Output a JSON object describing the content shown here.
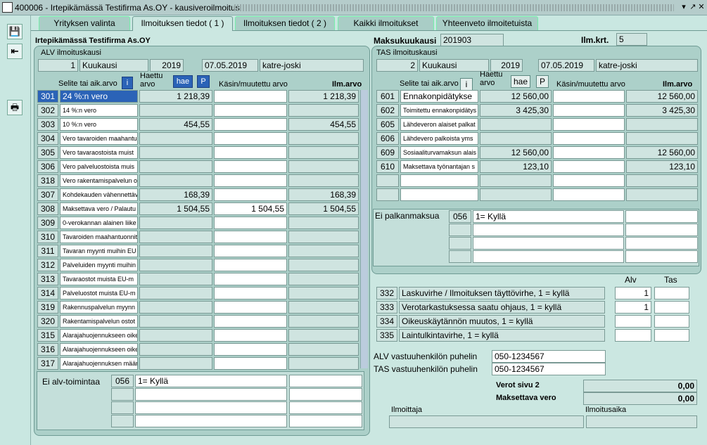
{
  "window": {
    "title": "400006 - Irtepikämässä Testifirma As.OY - kausiveroilmoitus"
  },
  "tabs": [
    "Yrityksen valinta",
    "Ilmoituksen tiedot ( 1 )",
    "Ilmoituksen tiedot ( 2 )",
    "Kaikki ilmoitukset",
    "Yhteenveto ilmoitetuista"
  ],
  "company": "Irtepikämässä Testifirma As.OY",
  "maksukuukausi": {
    "label": "Maksukuukausi",
    "value": "201903"
  },
  "ilmkrt": {
    "label": "Ilm.krt.",
    "value": "5"
  },
  "alv": {
    "title": "ALV ilmoituskausi",
    "period_num": "1",
    "period_type": "Kuukausi",
    "year": "2019",
    "date": "07.05.2019",
    "user": "katre-joski",
    "col_selite": "Selite tai aik.arvo",
    "col_haettu1": "Haettu",
    "col_haettu2": "arvo",
    "col_kasin": "Käsin/muutettu arvo",
    "col_ilm": "Ilm.arvo",
    "btn_i": "i",
    "btn_hae": "hae",
    "btn_p": "P",
    "rows": [
      {
        "code": "301",
        "desc": "24 %:n vero",
        "haettu": "1 218,39",
        "kasin": "",
        "ilm": "1 218,39"
      },
      {
        "code": "302",
        "desc": "14 %:n vero",
        "haettu": "",
        "kasin": "",
        "ilm": ""
      },
      {
        "code": "303",
        "desc": "10 %:n vero",
        "haettu": "454,55",
        "kasin": "",
        "ilm": "454,55"
      },
      {
        "code": "304",
        "desc": "Vero tavaroiden maahantu",
        "haettu": "",
        "kasin": "",
        "ilm": ""
      },
      {
        "code": "305",
        "desc": "Vero tavaraostoista muist",
        "haettu": "",
        "kasin": "",
        "ilm": ""
      },
      {
        "code": "306",
        "desc": "Vero palveluostoista muis",
        "haettu": "",
        "kasin": "",
        "ilm": ""
      },
      {
        "code": "318",
        "desc": "Vero rakentamispalvelun o",
        "haettu": "",
        "kasin": "",
        "ilm": ""
      },
      {
        "code": "307",
        "desc": "Kohdekauden vähennettäv",
        "haettu": "168,39",
        "kasin": "",
        "ilm": "168,39"
      },
      {
        "code": "308",
        "desc": "Maksettava vero / Palautu",
        "haettu": "1 504,55",
        "kasin": "1 504,55",
        "ilm": "1 504,55"
      },
      {
        "code": "309",
        "desc": "0-verokannan alainen liike",
        "haettu": "",
        "kasin": "",
        "ilm": ""
      },
      {
        "code": "310",
        "desc": "Tavaroiden maahantuonnit",
        "haettu": "",
        "kasin": "",
        "ilm": ""
      },
      {
        "code": "311",
        "desc": "Tavaran myynti muihin EU",
        "haettu": "",
        "kasin": "",
        "ilm": ""
      },
      {
        "code": "312",
        "desc": "Palveluiden myynti muihin",
        "haettu": "",
        "kasin": "",
        "ilm": ""
      },
      {
        "code": "313",
        "desc": "Tavaraostot muista EU-m",
        "haettu": "",
        "kasin": "",
        "ilm": ""
      },
      {
        "code": "314",
        "desc": "Palveluostot muista EU-m",
        "haettu": "",
        "kasin": "",
        "ilm": ""
      },
      {
        "code": "319",
        "desc": "Rakennuspalvelun myynn",
        "haettu": "",
        "kasin": "",
        "ilm": ""
      },
      {
        "code": "320",
        "desc": "Rakentamispalvelun ostot",
        "haettu": "",
        "kasin": "",
        "ilm": ""
      },
      {
        "code": "315",
        "desc": "Alarajahuojennukseen oike",
        "haettu": "",
        "kasin": "",
        "ilm": ""
      },
      {
        "code": "316",
        "desc": "Alarajahuojennukseen oike",
        "haettu": "",
        "kasin": "",
        "ilm": ""
      },
      {
        "code": "317",
        "desc": "Alarajahuojennuksen määr",
        "haettu": "",
        "kasin": "",
        "ilm": ""
      }
    ],
    "ei_toimintaa": {
      "label": "Ei alv-toimintaa",
      "code": "056",
      "value": "1= Kyllä"
    }
  },
  "tas": {
    "title": "TAS ilmoituskausi",
    "period_num": "2",
    "period_type": "Kuukausi",
    "year": "2019",
    "date": "07.05.2019",
    "user": "katre-joski",
    "rows": [
      {
        "code": "601",
        "desc": "Ennakonpidätykse",
        "haettu": "12 560,00",
        "kasin": "",
        "ilm": "12 560,00"
      },
      {
        "code": "602",
        "desc": "Toimitettu ennakonpidätys",
        "haettu": "3 425,30",
        "kasin": "",
        "ilm": "3 425,30"
      },
      {
        "code": "605",
        "desc": "Lähdeveron alaiset palkat",
        "haettu": "",
        "kasin": "",
        "ilm": ""
      },
      {
        "code": "606",
        "desc": "Lähdevero palkoista yms",
        "haettu": "",
        "kasin": "",
        "ilm": ""
      },
      {
        "code": "609",
        "desc": "Sosiaaliturvamaksun alais",
        "haettu": "12 560,00",
        "kasin": "",
        "ilm": "12 560,00"
      },
      {
        "code": "610",
        "desc": "Maksettava työnantajan s",
        "haettu": "123,10",
        "kasin": "",
        "ilm": "123,10"
      }
    ],
    "ei_palkanmaksua": {
      "label": "Ei palkanmaksua",
      "code": "056",
      "value": "1= Kyllä"
    }
  },
  "corrections": {
    "col_alv": "Alv",
    "col_tas": "Tas",
    "rows": [
      {
        "code": "332",
        "desc": "Laskuvirhe / Ilmoituksen täyttövirhe, 1 = kyllä",
        "alv": "1",
        "tas": ""
      },
      {
        "code": "333",
        "desc": "Verotarkastuksessa saatu ohjaus, 1 = kyllä",
        "alv": "1",
        "tas": ""
      },
      {
        "code": "334",
        "desc": "Oikeuskäytännön muutos, 1 = kyllä",
        "alv": "",
        "tas": ""
      },
      {
        "code": "335",
        "desc": "Laintulkintavirhe, 1 = kyllä",
        "alv": "",
        "tas": ""
      }
    ]
  },
  "contacts": {
    "alv_label": "ALV vastuuhenkilön puhelin",
    "alv_value": "050-1234567",
    "tas_label": "TAS vastuuhenkilön puhelin",
    "tas_value": "050-1234567"
  },
  "summary": {
    "verot_label": "Verot sivu 2",
    "verot_value": "0,00",
    "maksettava_label": "Maksettava vero",
    "maksettava_value": "0,00",
    "ilmoittaja_label": "Ilmoittaja",
    "ilmoitusaika_label": "Ilmoitusaika"
  },
  "toolbar_icons": [
    "save-icon",
    "exit-icon",
    "print-icon"
  ]
}
